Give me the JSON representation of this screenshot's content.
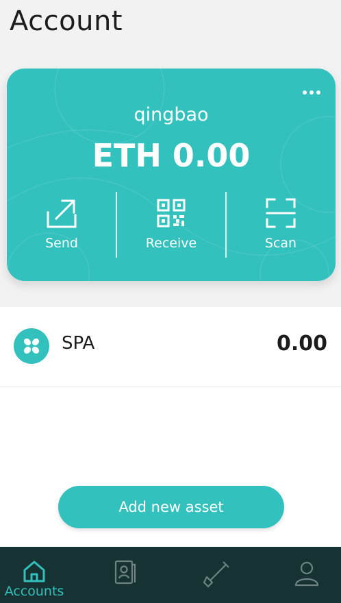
{
  "header": {
    "title": "Account"
  },
  "wallet_card": {
    "account_name": "qingbao",
    "balance": "ETH 0.00",
    "actions": [
      {
        "label": "Send",
        "icon": "send-icon"
      },
      {
        "label": "Receive",
        "icon": "qr-code-icon"
      },
      {
        "label": "Scan",
        "icon": "scan-icon"
      }
    ],
    "menu_icon": "more-dots-icon"
  },
  "assets": [
    {
      "symbol": "SPA",
      "amount": "0.00",
      "icon": "spa-token-icon"
    }
  ],
  "add_asset_label": "Add new asset",
  "tabbar": {
    "tabs": [
      {
        "label": "Accounts",
        "icon": "home-icon",
        "active": true
      },
      {
        "label": "",
        "icon": "contacts-icon",
        "active": false
      },
      {
        "label": "",
        "icon": "shovel-icon",
        "active": false
      },
      {
        "label": "",
        "icon": "profile-icon",
        "active": false
      }
    ]
  },
  "colors": {
    "accent": "#33c1be",
    "tabbar_bg": "#173232",
    "text": "#1c1c1c"
  }
}
